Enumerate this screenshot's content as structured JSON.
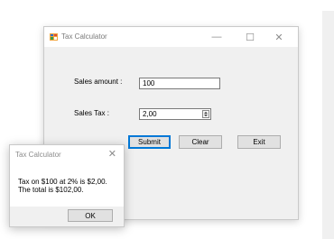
{
  "main_window": {
    "title": "Tax Calculator",
    "controls": {
      "minimize": "—",
      "maximize": "☐",
      "close": "✕"
    },
    "sales_amount_label": "Sales amount :",
    "sales_amount_value": "100",
    "sales_tax_label": "Sales Tax :",
    "sales_tax_value": "2,00",
    "submit_label": "Submit",
    "clear_label": "Clear",
    "exit_label": "Exit"
  },
  "message_box": {
    "title": "Tax Calculator",
    "close": "✕",
    "line1": "Tax on $100 at 2% is $2,00.",
    "line2": "The total is $102,00.",
    "ok_label": "OK"
  },
  "icons": {
    "app": "calculator-app-icon",
    "accent_color": "#0078d7"
  }
}
